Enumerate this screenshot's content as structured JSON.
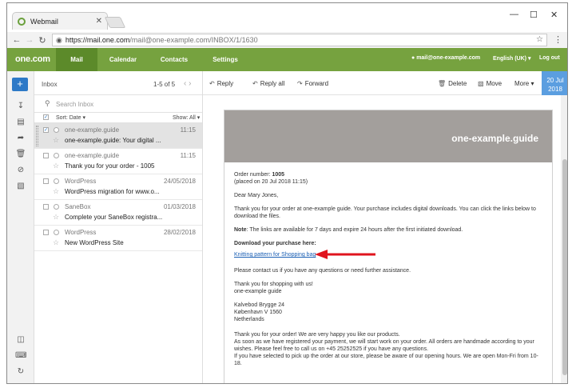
{
  "browser": {
    "tab_title": "Webmail",
    "tab_close": "✕",
    "win_min": "—",
    "win_max": "☐",
    "win_close": "✕",
    "back_icon": "←",
    "forward_icon": "→",
    "reload_icon": "↻",
    "url_domain": "https://mail.one.com",
    "url_path": "/mail@one-example.com/INBOX/1/1630",
    "menu_icon": "⋮"
  },
  "app": {
    "logo": "one.com",
    "nav": [
      "Mail",
      "Calendar",
      "Contacts",
      "Settings"
    ],
    "user": "mail@one-example.com",
    "language": "English (UK) ▾",
    "logout": "Log out",
    "compose": "+"
  },
  "list": {
    "folder": "Inbox",
    "count": "1-5 of 5",
    "arrows": "‹  ›",
    "search_placeholder": "Search Inbox",
    "sort": "Sort: Date ▾",
    "show": "Show: All ▾",
    "items": [
      {
        "from": "one-example.guide",
        "date": "11:15",
        "subject": "one-example.guide: Your digital ..."
      },
      {
        "from": "one-example.guide",
        "date": "11:15",
        "subject": "Thank you for your order - 1005"
      },
      {
        "from": "WordPress",
        "date": "24/05/2018",
        "subject": "WordPress migration for www.o..."
      },
      {
        "from": "SaneBox",
        "date": "01/03/2018",
        "subject": "Complete your SaneBox registra..."
      },
      {
        "from": "WordPress",
        "date": "28/02/2018",
        "subject": "New WordPress Site"
      }
    ]
  },
  "toolbar": {
    "reply": "Reply",
    "reply_all": "Reply all",
    "forward": "Forward",
    "delete": "Delete",
    "move": "Move",
    "more": "More ▾",
    "date_line1": "20 Jul",
    "date_line2": "2018"
  },
  "email": {
    "banner": "one-example.guide",
    "order_label": "Order number: ",
    "order_number": "1005",
    "placed": "(placed on 20 Jul 2018 11:15)",
    "greeting": "Dear Mary Jones,",
    "para1": "Thank you for your order at one-example guide. Your purchase includes digital downloads. You can click the links below to download the files.",
    "note_label": "Note",
    "note_text": ": The links are available for 7 days and expire 24 hours after the first initiated download.",
    "download_heading": "Download your purchase here:",
    "download_link": "Knitting pattern for Shopping bag",
    "contact": "Please contact us if you have any questions or need further assistance.",
    "thanks1": "Thank you for shopping with us!",
    "thanks2": "one-example guide",
    "addr1": "Kalvebod Brygge 24",
    "addr2": "København V 1560",
    "addr3": "Netherlands",
    "closing1": "Thank you for your order! We are very happy you like our products.",
    "closing2": "As soon as we have registered your payment, we will start work on your order. All orders are handmade according to your wishes. Please feel free to call us on +45 25252525 if you have any questions.",
    "closing3": "If you have selected to pick up the order at our store, please be aware of our opening hours. We are open Mon-Fri from 10-18."
  },
  "colors": {
    "brand_green": "#76a23f",
    "accent_blue": "#2d79c7",
    "arrow_red": "#e0141e"
  }
}
